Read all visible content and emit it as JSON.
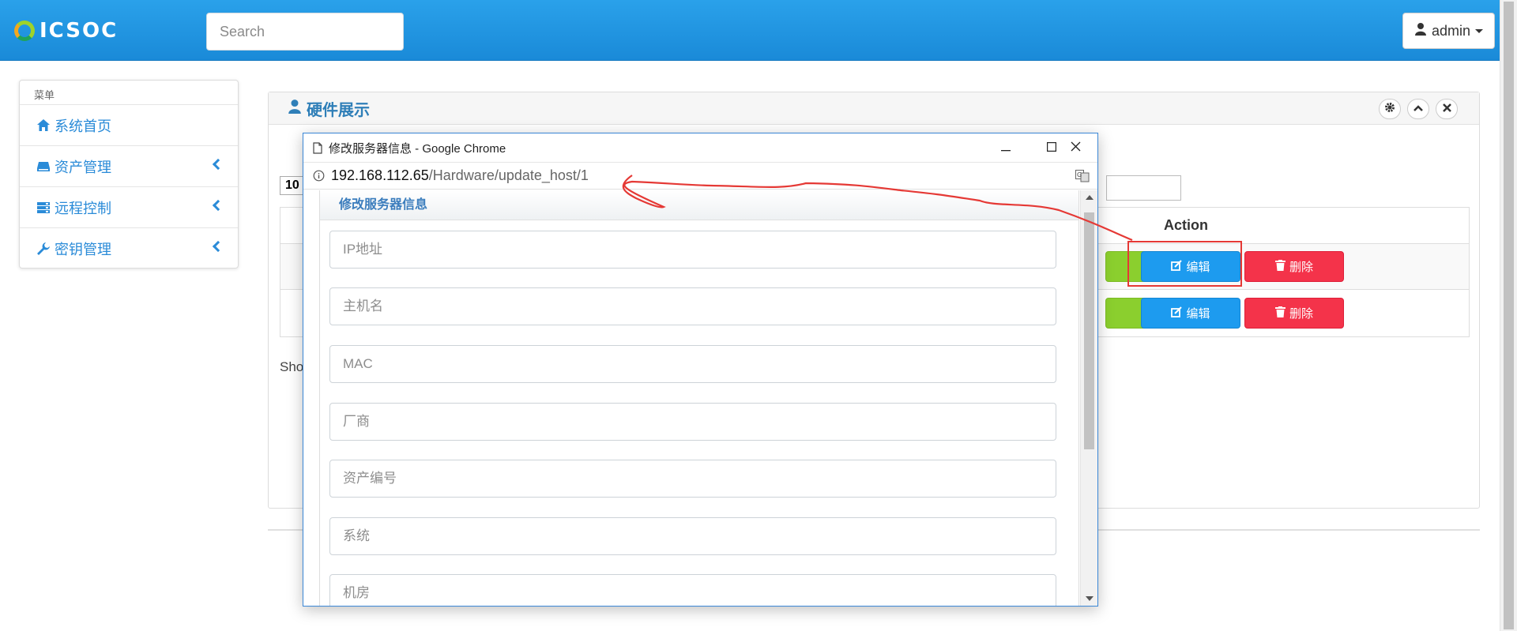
{
  "header": {
    "logo_text": "ICSOC",
    "search_placeholder": "Search",
    "user_label": "admin"
  },
  "sidebar": {
    "heading": "菜单",
    "items": [
      {
        "label": "系统首页",
        "icon": "home-icon"
      },
      {
        "label": "资产管理",
        "icon": "drive-icon"
      },
      {
        "label": "远程控制",
        "icon": "server-icon"
      },
      {
        "label": "密钥管理",
        "icon": "wrench-icon"
      }
    ]
  },
  "panel": {
    "title": "硬件展示",
    "page_size": "10",
    "show_text": "Sho",
    "table": {
      "action_header": "Action",
      "rows": [
        {
          "edit": "编辑",
          "delete": "删除"
        },
        {
          "edit": "编辑",
          "delete": "删除"
        }
      ]
    }
  },
  "popup": {
    "window_title": "修改服务器信息 - Google Chrome",
    "url_host": "192.168.112.65",
    "url_path": "/Hardware/update_host/1",
    "form_title": "修改服务器信息",
    "fields": [
      {
        "placeholder": "IP地址"
      },
      {
        "placeholder": "主机名"
      },
      {
        "placeholder": "MAC"
      },
      {
        "placeholder": "厂商"
      },
      {
        "placeholder": "资产编号"
      },
      {
        "placeholder": "系统"
      },
      {
        "placeholder": "机房"
      }
    ]
  },
  "colors": {
    "header_blue": "#1a8ad8",
    "edit_blue": "#1d9bef",
    "delete_red": "#f4334a",
    "view_green": "#8bcf2e",
    "annotation_red": "#e53935"
  }
}
